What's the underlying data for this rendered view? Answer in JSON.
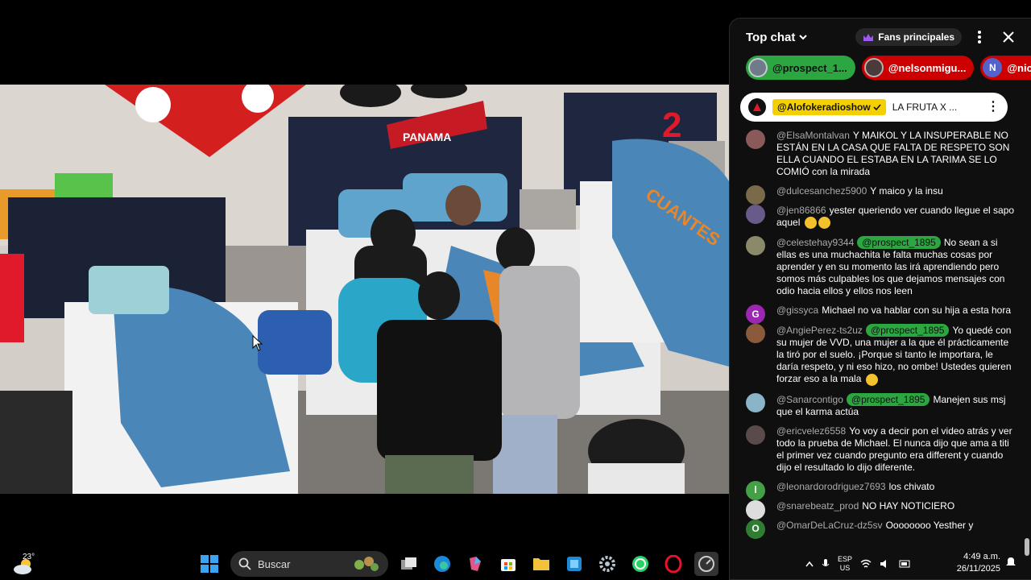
{
  "chat": {
    "title": "Top chat",
    "fans_button": "Fans principales",
    "pills": [
      {
        "name": "@prospect_1...",
        "style": "green"
      },
      {
        "name": "@nelsonmigu...",
        "style": "red"
      },
      {
        "name": "@nicola",
        "style": "red",
        "initial": "N"
      }
    ],
    "pinned": {
      "channel": "@Alofokeradioshow",
      "text": "LA FRUTA X ..."
    },
    "messages": [
      {
        "author": "@ElsaMontalvan",
        "text": "Y MAIKOL Y LA INSUPERABLE NO ESTÁN EN LA CASA QUE FALTA DE RESPETO SON ELLA CUANDO EL ESTABA EN LA TARIMA SE LO COMIÓ con la mirada",
        "avatar_color": "#8a5a5a"
      },
      {
        "author": "@dulcesanchez5900",
        "text": "Y maico y la insu",
        "avatar_color": "#7a6a4a"
      },
      {
        "author": "@jen86866",
        "text": "yester queriendo ver cuando llegue el sapo aquel",
        "avatar_color": "#6a5a8a",
        "emoji": true
      },
      {
        "author": "@celestehay9344",
        "mention": "@prospect_1895",
        "text": "No sean a si ellas es una muchachita le falta muchas cosas por aprender y en su momento las irá aprendiendo pero somos más culpables los que dejamos mensajes con odio hacia ellos y ellos nos leen",
        "avatar_color": "#8a8a6a"
      },
      {
        "author": "@gissyca",
        "text": "Michael no va hablar con su hija a esta hora",
        "avatar_color": "#9c27b0",
        "initial": "G"
      },
      {
        "author": "@AngiePerez-ts2uz",
        "mention": "@prospect_1895",
        "text": "Yo quedé con su mujer de VVD, una mujer a la que él prácticamente la tiró por el suelo. ¡Porque si tanto le importara, le daría respeto, y ni eso hizo, no ombe! Ustedes quieren forzar eso a la mala",
        "avatar_color": "#8a5a3a",
        "emoji": true
      },
      {
        "author": "@Sanarcontigo",
        "mention": "@prospect_1895",
        "text": "Manejen sus msj que el karma actúa",
        "avatar_color": "#8ab4c8"
      },
      {
        "author": "@ericvelez6558",
        "text": "Yo voy a decir pon el video atrás y ver todo la prueba de Michael. El nunca dijo que ama a titi el primer vez cuando pregunto era different y cuando dijo el resultado lo dijo diferente.",
        "avatar_color": "#5a4a4a"
      },
      {
        "author": "@leonardorodriguez7693",
        "text": "los chivato",
        "avatar_color": "#43a047",
        "initial": "l"
      },
      {
        "author": "@snarebeatz_prod",
        "text": "NO HAY NOTICIERO",
        "avatar_color": "#dddddd"
      },
      {
        "author": "@OmarDeLaCruz-dz5sv",
        "text": "Oooooooo Yesther y",
        "avatar_color": "#2e7d32",
        "initial": "O"
      }
    ]
  },
  "taskbar": {
    "temperature": "23°",
    "search_placeholder": "Buscar",
    "language_top": "ESP",
    "language_bottom": "US",
    "time": "4:49 a.m.",
    "date": "26/11/2025"
  },
  "video": {
    "banner_text": "PANAMA",
    "number_balloon": "2",
    "blanket_text": "CUANTES"
  }
}
